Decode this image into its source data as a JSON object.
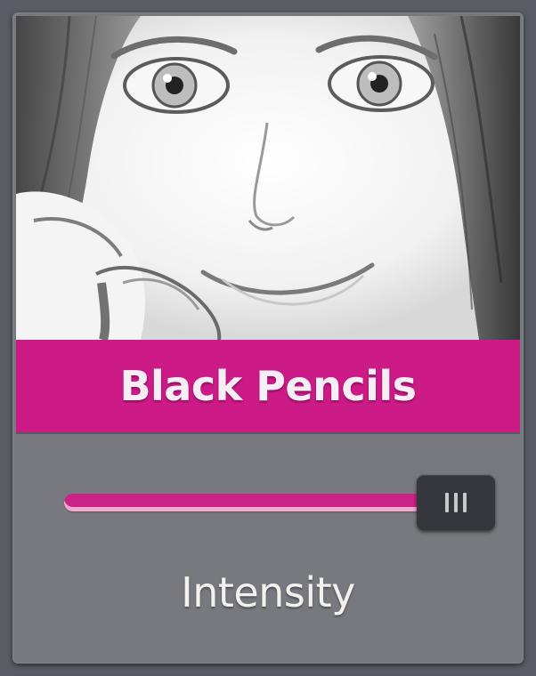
{
  "filter_card": {
    "title": "Black Pencils",
    "preview_icon": "portrait-preview-image",
    "accent_color": "#cc1a86",
    "intensity": {
      "label": "Intensity",
      "value_fraction": 1.0
    }
  }
}
